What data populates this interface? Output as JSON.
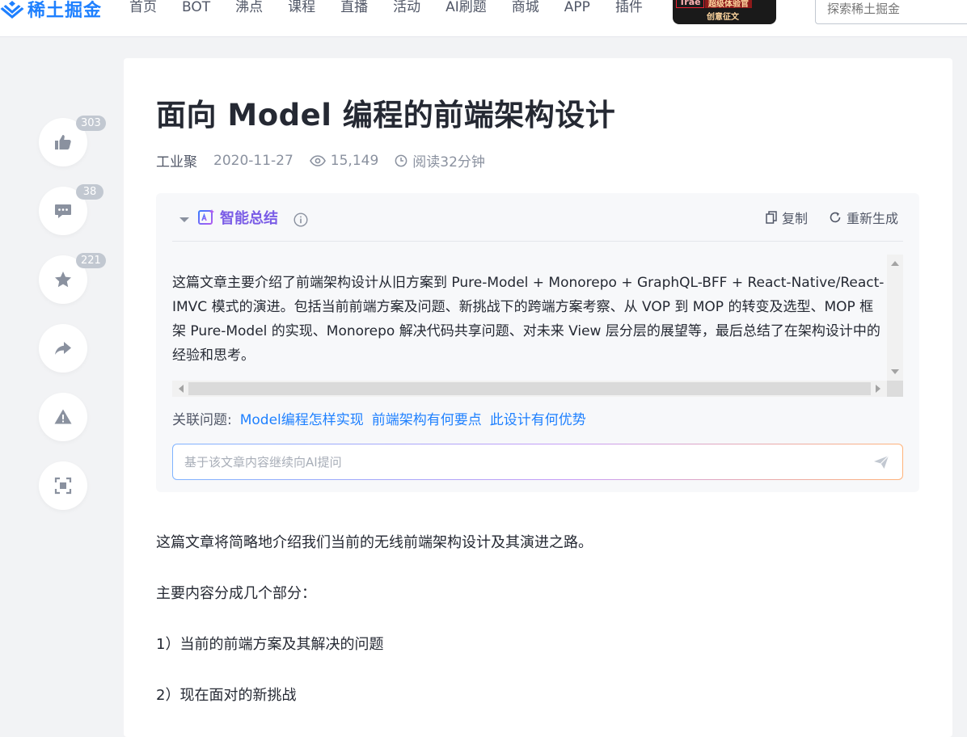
{
  "header": {
    "logo_text": "稀土掘金",
    "nav": [
      "首页",
      "BOT",
      "沸点",
      "课程",
      "直播",
      "活动",
      "AI刷题",
      "商城",
      "APP",
      "插件"
    ],
    "banner": {
      "tag": "Trae",
      "badge": "超级体验官",
      "subtitle": "创意征文"
    },
    "search_placeholder": "探索稀土掘金"
  },
  "sidebar": {
    "like_count": "303",
    "comment_count": "38",
    "collect_count": "221"
  },
  "article": {
    "title": "面向 Model 编程的前端架构设计",
    "author": "工业聚",
    "date": "2020-11-27",
    "views": "15,149",
    "read_time": "阅读32分钟"
  },
  "summary": {
    "title": "智能总结",
    "copy_label": "复制",
    "regenerate_label": "重新生成",
    "text": "这篇文章主要介绍了前端架构设计从旧方案到 Pure-Model + Monorepo + GraphQL-BFF + React-Native/React-IMVC 模式的演进。包括当前前端方案及问题、新挑战下的跨端方案考察、从 VOP 到 MOP 的转变及选型、MOP 框架 Pure-Model 的实现、Monorepo 解决代码共享问题、对未来 View 层分层的展望等，最后总结了在架构设计中的经验和思考。",
    "related_label": "关联问题:",
    "related_questions": [
      "Model编程怎样实现",
      "前端架构有何要点",
      "此设计有何优势"
    ],
    "ask_placeholder": "基于该文章内容继续向AI提问"
  },
  "body": {
    "p1": "这篇文章将简略地介绍我们当前的无线前端架构设计及其演进之路。",
    "p2": "主要内容分成几个部分：",
    "p3": "1）当前的前端方案及其解决的问题",
    "p4": "2）现在面对的新挑战"
  },
  "colors": {
    "accent": "#1e80ff",
    "ai_title": "#7a5ce6",
    "page_bg": "#f2f3f5"
  }
}
